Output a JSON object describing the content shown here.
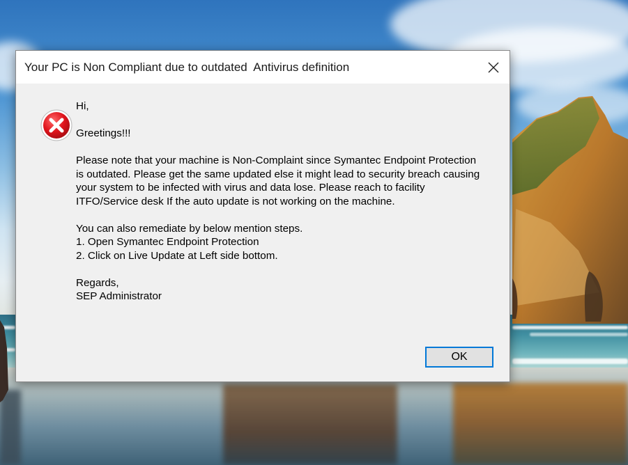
{
  "dialog": {
    "title": "Your PC is Non Compliant due to outdated  Antivirus definition",
    "close_icon": "close-icon",
    "status_icon": "error-icon",
    "message": {
      "line_greeting": "Hi,",
      "line_greetings": "Greetings!!!",
      "para1": [
        "Please note that your machine is Non-Complaint since Symantec Endpoint Protection",
        "is outdated. Please get the same updated else it might lead to security breach causing",
        "your system to be infected with virus and data lose. Please reach to facility",
        "ITFO/Service desk If the auto update is not working on the machine."
      ],
      "para2": [
        "You can also remediate by below mention steps.",
        "1. Open Symantec Endpoint Protection",
        "2. Click on Live Update at Left side bottom."
      ],
      "signoff": [
        "Regards,",
        "SEP Administrator"
      ]
    },
    "ok_label": "OK"
  },
  "colors": {
    "dialog_bg": "#f0f0f0",
    "titlebar_bg": "#ffffff",
    "button_focus_border": "#0078d7",
    "error_red": "#d0131b"
  }
}
